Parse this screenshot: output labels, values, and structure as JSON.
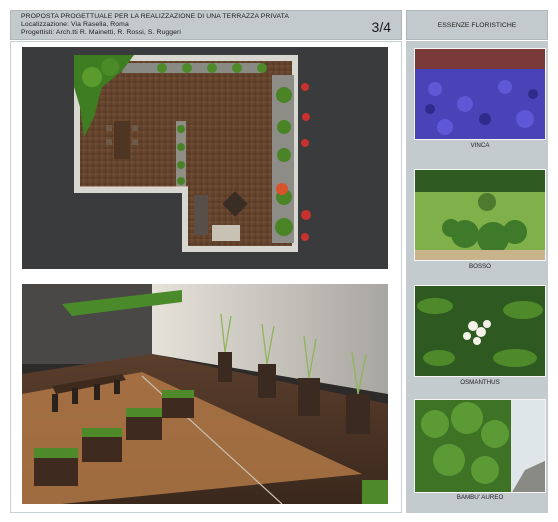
{
  "header": {
    "line1": "PROPOSTA PROGETTUALE PER LA REALIZZAZIONE DI UNA TERRAZZA PRIVATA",
    "line2": "Localizzazione: Via Rasella, Roma",
    "line3": "Progettisti: Arch.tti   R. Mainetti, R. Rossi, S. Ruggeri",
    "page": "3/4"
  },
  "sidebar": {
    "title": "ESSENZE FLORISTICHE",
    "plants": [
      {
        "name": "VINCA"
      },
      {
        "name": "BOSSO"
      },
      {
        "name": "OSMANTHUS"
      },
      {
        "name": "BAMBU' AUREO"
      }
    ]
  },
  "colors": {
    "header_bg": "#c2cacd",
    "sidebar_bg": "#c3cbce",
    "deck": "#6b4a35",
    "greenery": "#4f8a2a",
    "accent_red": "#c8322e"
  },
  "icons": {
    "plan": "plan-render-illustration",
    "perspective": "perspective-render-illustration"
  }
}
